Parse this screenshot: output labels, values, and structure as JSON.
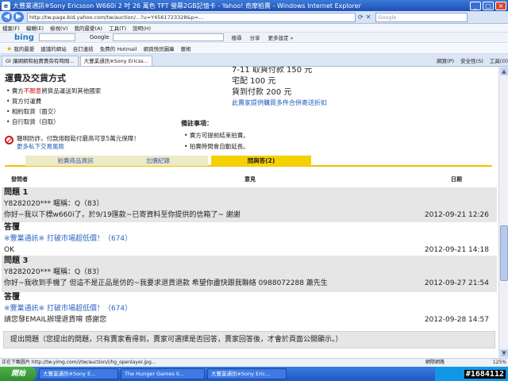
{
  "window": {
    "title": "大豐業通訊※Sony Ericsson W660i 2 吋 26 萬色 TFT 螢幕2GB記憶卡 - Yahoo! 奇摩拍賣 - Windows Internet Explorer",
    "address": "http://tw.page.bid.yahoo.com/tw/auction/...?u=Y4561723328&p=...",
    "search_placeholder": "Google"
  },
  "menu": [
    "檔案(F)",
    "編輯(E)",
    "檢視(V)",
    "我的最愛(A)",
    "工具(T)",
    "說明(H)"
  ],
  "bing_toolbar": {
    "logo": "bing",
    "google_label": "Google",
    "tools": [
      "搜尋",
      "分享",
      "更多設定 »"
    ]
  },
  "favorites": {
    "label": "我的最愛",
    "items": [
      "建議的網站",
      "自訂連結",
      "免費的 Hotmail",
      "網頁快訊圖庫",
      "藝術"
    ]
  },
  "tabs": [
    {
      "label": "Gl 讓網網和拍賣賣旁有時問..."
    },
    {
      "label": "大豐業通訊※Sony Ericss...",
      "active": true
    }
  ],
  "tab_tools": [
    "網頁(P)",
    "安全性(S)",
    "工具(O)"
  ],
  "shipping": {
    "title": "運費及交貨方式",
    "items": [
      {
        "pre": "賣方",
        "red": "不願意",
        "post": "將貨品運送到其他國家"
      },
      {
        "pre": "買方付運費",
        "red": "",
        "post": ""
      },
      {
        "pre": "相約取貨（面交）",
        "red": "",
        "post": ""
      },
      {
        "pre": "自行取貨（自取）",
        "red": "",
        "post": ""
      }
    ],
    "prices": [
      "7-11 取貨付款 150 元",
      "宅配 100 元",
      "貨到付款 200 元"
    ],
    "price_link": "此賣家提供購買多件合併寄送折扣"
  },
  "warning": {
    "line1": "聰明防詐，付款用輕鬆付最高可享5萬元保障！",
    "link": "更多私下交易風險"
  },
  "remarks": {
    "title": "備註事項：",
    "items": [
      "賣方可提前結束拍賣。",
      "拍賣時間會自動延長。"
    ]
  },
  "section_tabs": [
    "拍賣商品資訊",
    "出價紀錄",
    "問與答(2)"
  ],
  "qa_header": {
    "asker": "發問者",
    "opinion": "意見",
    "date": "日期"
  },
  "qa": [
    {
      "label": "問題 1",
      "user_line": "Y8282020*** 暱稱：Q（83）",
      "text": "你好~我以下標w660i了，於9/19匯款~已寄資料至你提供的信箱了~ 謝謝",
      "date": "2012-09-21 12:26",
      "answer_label": "答覆",
      "seller": "※豐業通訊※ 打破市場超低價！（674）",
      "answer": "OK",
      "answer_date": "2012-09-21 14:18"
    },
    {
      "label": "問題 3",
      "user_line": "Y8282020*** 暱稱：Q（83）",
      "text": "你好~我收到手機了 但這不是正品是仿的~我要求退貨退款 希望你盡快跟我聯絡 0988072288 蕭先生",
      "date": "2012-09-27 21:54",
      "answer_label": "答覆",
      "seller": "※豐業通訊※ 打破市場超低價！（674）",
      "answer": "請您發EMAIL辦理退貨唷 感謝您",
      "answer_date": "2012-09-28 14:57"
    }
  ],
  "ask_box": "提出問題（您提出的問題，只有賣家看得到，賣家可選擇是否回答，賣家回答後，才會於頁面公開顯示。）",
  "statusbar": {
    "text": "正在下載圖片 http://tw.yimg.com/i/tw/auction/i/hg_openlayer.jpg...",
    "zone": "網際網路",
    "zoom": "125%"
  },
  "taskbar": {
    "start": "開始",
    "tasks": [
      "大豐業通訊※Sony E...",
      "The Hunger Games II...",
      "大豐業通訊※Sony Eric..."
    ],
    "watermark": "#1684112"
  }
}
